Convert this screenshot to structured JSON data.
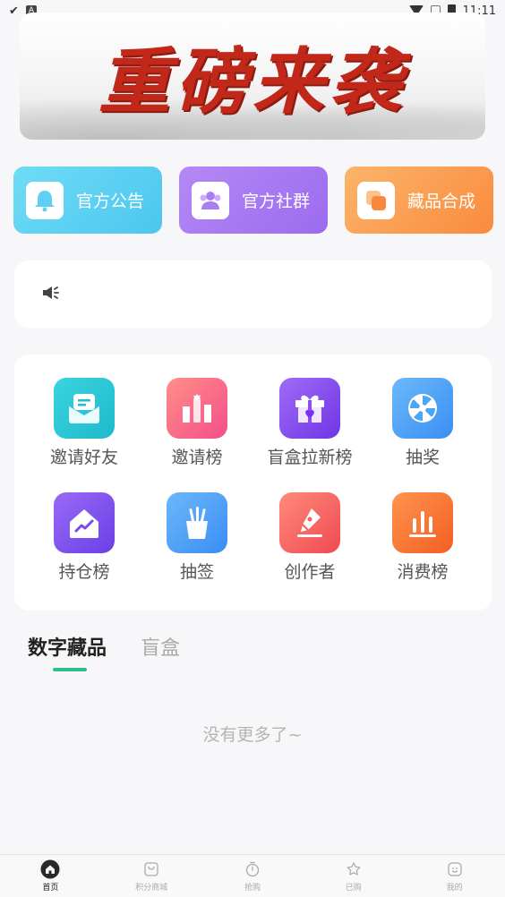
{
  "status_bar": {
    "time": "11:11",
    "a_badge": "A"
  },
  "banner": {
    "title": "重磅来袭"
  },
  "quick_actions": [
    {
      "label": "官方公告",
      "icon": "bell-icon"
    },
    {
      "label": "官方社群",
      "icon": "group-icon"
    },
    {
      "label": "藏品合成",
      "icon": "stack-icon"
    }
  ],
  "grid": [
    {
      "label": "邀请好友",
      "icon": "envelope-icon",
      "color": "#2ecad6"
    },
    {
      "label": "邀请榜",
      "icon": "bar-chart-icon",
      "color": "#f86a8c"
    },
    {
      "label": "盲盒拉新榜",
      "icon": "gift-icon",
      "color": "#8b4ef0"
    },
    {
      "label": "抽奖",
      "icon": "wheel-icon",
      "color": "#4ba6f7"
    },
    {
      "label": "持仓榜",
      "icon": "house-chart-icon",
      "color": "#7b49ec"
    },
    {
      "label": "抽签",
      "icon": "sticks-icon",
      "color": "#49a4f6"
    },
    {
      "label": "创作者",
      "icon": "pen-icon",
      "color": "#f7615a"
    },
    {
      "label": "消费榜",
      "icon": "column-chart-icon",
      "color": "#f76d2c"
    }
  ],
  "tabs": {
    "active": "数字藏品",
    "inactive": "盲盒"
  },
  "empty_text": "没有更多了~",
  "nav": [
    {
      "label": "首页",
      "icon": "home-icon",
      "active": true
    },
    {
      "label": "积分商城",
      "icon": "shop-icon",
      "active": false
    },
    {
      "label": "抢购",
      "icon": "timer-icon",
      "active": false
    },
    {
      "label": "已购",
      "icon": "star-icon",
      "active": false
    },
    {
      "label": "我的",
      "icon": "smile-icon",
      "active": false
    }
  ],
  "accent": "#2bbf8a"
}
